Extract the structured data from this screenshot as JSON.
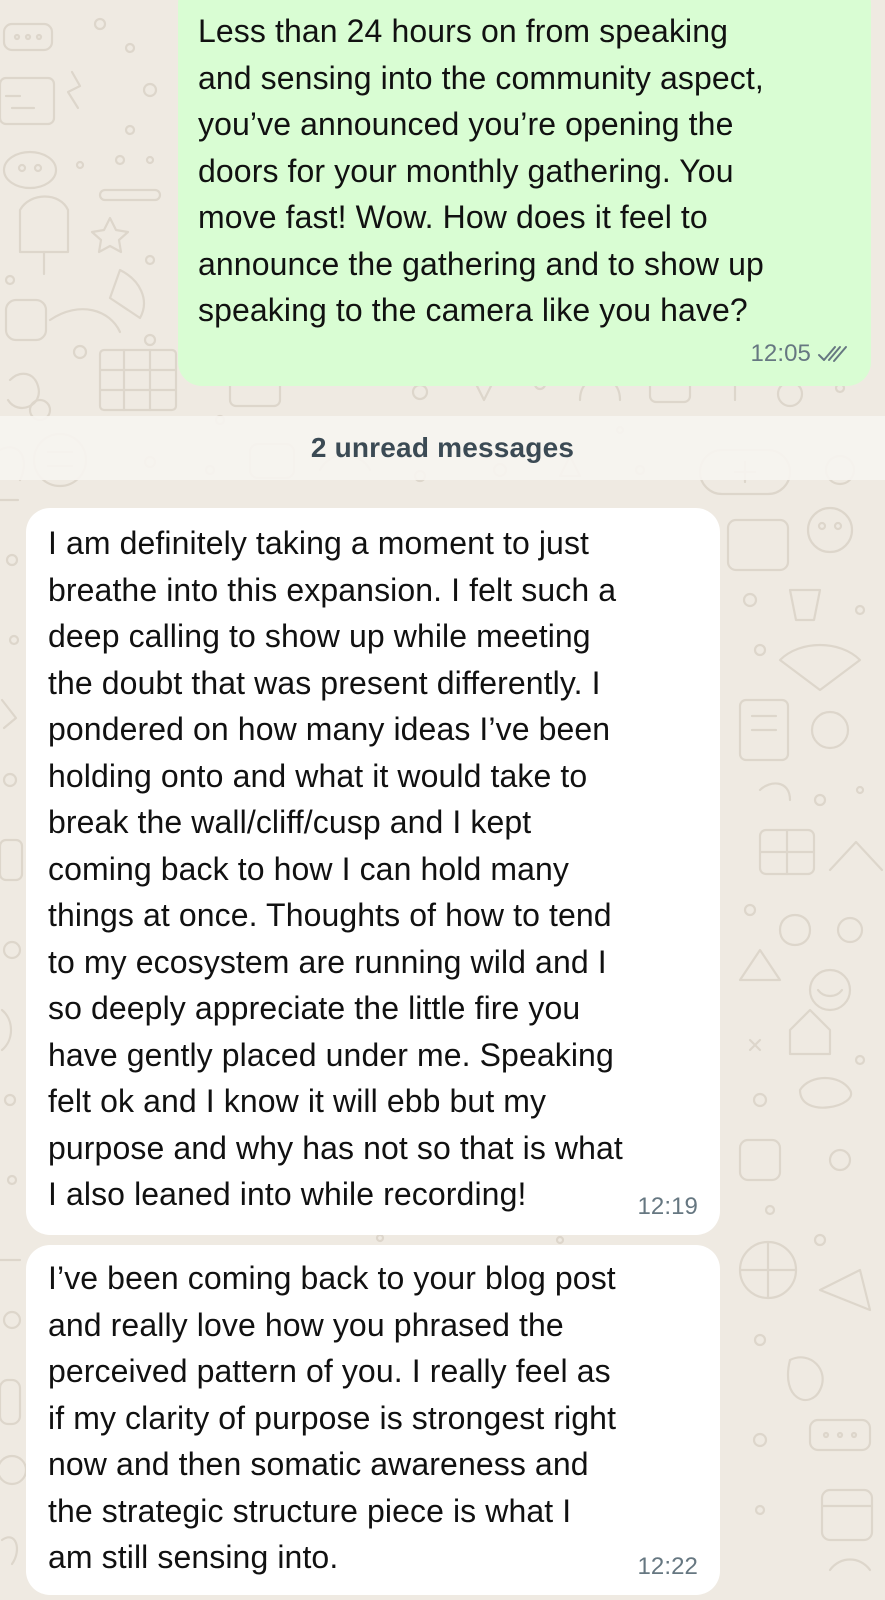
{
  "chat": {
    "outgoing": {
      "text": "Less than 24 hours on from speaking\nand sensing into the community aspect,\nyou’ve announced you’re opening the\ndoors for your monthly gathering. You\nmove fast! Wow. How does it feel to\nannounce the gathering and to show up\nspeaking to the camera like you have?",
      "time": "12:05",
      "status_icon": "double-check-icon"
    },
    "unread_banner": "2 unread messages",
    "incoming": [
      {
        "text": "I am definitely taking a moment to just\nbreathe into this expansion. I felt such a\ndeep calling to show up while meeting\nthe doubt that was present differently. I\npondered on how many ideas I’ve been\nholding onto  and what it would take to\nbreak the wall/cliff/cusp and I kept\ncoming back to how I can hold many\nthings at once. Thoughts of how to tend\nto my ecosystem are running wild and I\nso deeply appreciate the little fire you\nhave gently placed under me. Speaking\nfelt ok and I know it will ebb but my\npurpose and why has not so that is what\nI also leaned into while recording!",
        "time": "12:19"
      },
      {
        "text": "I’ve been coming back to your blog post\nand really love how you phrased the\nperceived pattern of you. I really feel as\nif my clarity of purpose is strongest right\nnow and then somatic awareness and\nthe strategic structure piece is what I\nam still sensing into.",
        "time": "12:22"
      }
    ]
  },
  "colors": {
    "chat_background": "#efeae2",
    "outgoing_bubble": "#d9fdd3",
    "incoming_bubble": "#ffffff",
    "timestamp": "#667781",
    "unread_banner_text": "#3b4a54"
  }
}
